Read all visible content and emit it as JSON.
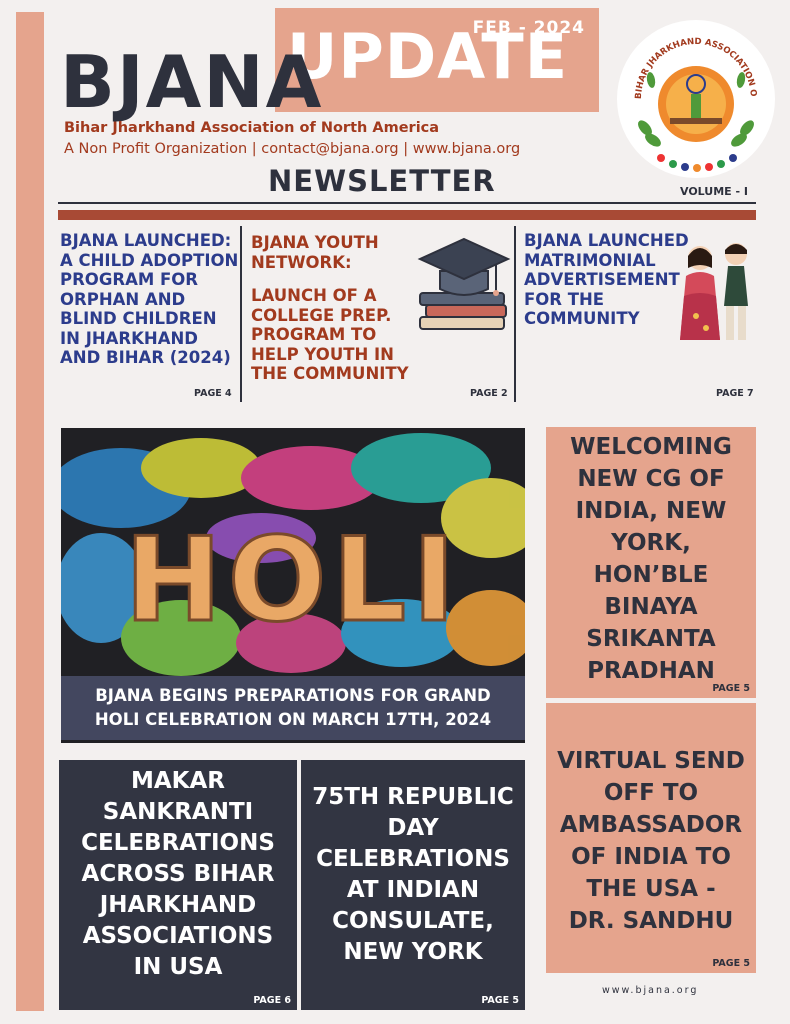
{
  "header": {
    "date": "FEB - 2024",
    "update_word": "UPDATE",
    "brand": "BJANA",
    "org_name": "Bihar Jharkhand Association of North America",
    "tagline": "A Non Profit Organization | contact@bjana.org | www.bjana.org",
    "newsletter": "NEWSLETTER",
    "volume": "VOLUME - I",
    "logo_ring_text": "BIHAR JHARKHAND ASSOCIATION OF NORTH AMERICA"
  },
  "top_stories": [
    {
      "title": "BJANA LAUNCHED: A CHILD ADOPTION PROGRAM FOR ORPHAN AND BLIND CHILDREN IN JHARKHAND AND BIHAR (2024)",
      "page": "PAGE 4"
    },
    {
      "heading": "BJANA YOUTH NETWORK:",
      "title": "LAUNCH OF A COLLEGE PREP. PROGRAM TO HELP YOUTH IN THE COMMUNITY",
      "page": "PAGE 2"
    },
    {
      "title": "BJANA LAUNCHED MATRIMONIAL ADVERTISEMENT FOR THE COMMUNITY",
      "page": "PAGE 7"
    }
  ],
  "holi": {
    "image_word": "HOLI",
    "caption_line1": "BJANA BEGINS PREPARATIONS FOR GRAND",
    "caption_line2": "HOLI CELEBRATION ON MARCH 17TH, 2024"
  },
  "side_boxes": [
    {
      "lines": [
        "WELCOMING",
        "NEW CG OF",
        "INDIA, NEW",
        "YORK,",
        "HON’BLE",
        "BINAYA",
        "SRIKANTA",
        "PRADHAN"
      ],
      "page": "PAGE 5"
    },
    {
      "lines": [
        "VIRTUAL SEND",
        "OFF  TO",
        "AMBASSADOR",
        "OF INDIA TO",
        "THE USA -",
        "DR. SANDHU"
      ],
      "page": "PAGE 5"
    }
  ],
  "bottom_boxes": [
    {
      "lines": [
        "MAKAR",
        "SANKRANTI",
        "CELEBRATIONS",
        "ACROSS BIHAR",
        "JHARKHAND",
        "ASSOCIATIONS",
        "IN USA"
      ],
      "page": "PAGE 6"
    },
    {
      "lines": [
        "75TH REPUBLIC",
        "DAY",
        "CELEBRATIONS",
        "AT INDIAN",
        "CONSULATE,",
        "NEW YORK"
      ],
      "page": "PAGE 5"
    }
  ],
  "footer": {
    "website": "www.bjana.org"
  },
  "colors": {
    "accent": "#e5a48d",
    "dark": "#2e313d",
    "rust": "#a84a35",
    "blue": "#2c3c8c"
  },
  "icons": [
    "graduation-cap-icon",
    "wedding-couple-icon",
    "association-logo"
  ]
}
